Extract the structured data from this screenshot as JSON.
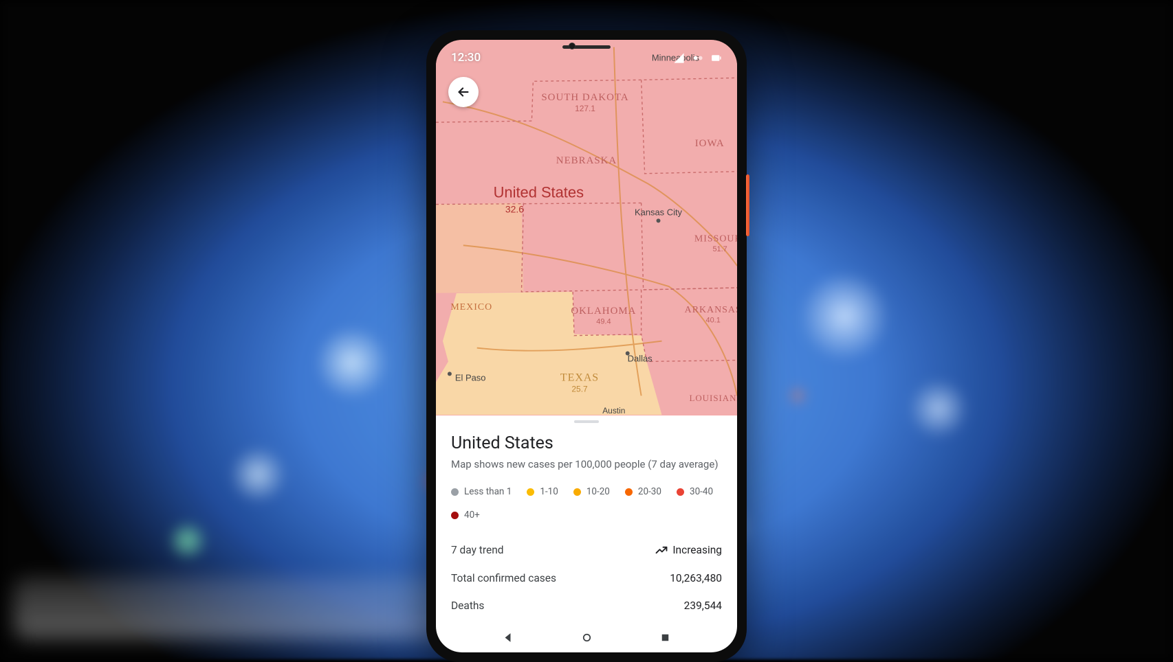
{
  "status_bar": {
    "time": "12:30"
  },
  "map_labels": {
    "minneapolis": "Minneapolis",
    "south_dakota": "SOUTH DAKOTA",
    "south_dakota_value": "127.1",
    "iowa": "IOWA",
    "nebraska": "NEBRASKA",
    "kansas_city": "Kansas City",
    "missouri": "MISSOURI",
    "missouri_value": "51.7",
    "country": "United States",
    "country_value": "32.6",
    "mexico": "MEXICO",
    "oklahoma": "OKLAHOMA",
    "oklahoma_value": "49.4",
    "arkansas": "ARKANSAS",
    "arkansas_value": "40.1",
    "el_paso": "El Paso",
    "texas": "TEXAS",
    "texas_value": "25.7",
    "dallas": "Dallas",
    "austin": "Austin",
    "louisiana": "LOUISIANA"
  },
  "sheet": {
    "title": "United States",
    "subtitle": "Map shows new cases per 100,000 people (7 day average)",
    "trend_label": "7 day trend",
    "trend_value": "Increasing",
    "confirmed_label": "Total confirmed cases",
    "confirmed_value": "10,263,480",
    "deaths_label": "Deaths",
    "deaths_value": "239,544"
  },
  "legend": [
    {
      "color": "#9aa0a6",
      "label": "Less than 1"
    },
    {
      "color": "#fbbc04",
      "label": "1-10"
    },
    {
      "color": "#f9ab00",
      "label": "10-20"
    },
    {
      "color": "#f76700",
      "label": "20-30"
    },
    {
      "color": "#ea4335",
      "label": "30-40"
    },
    {
      "color": "#a50e0e",
      "label": "40+"
    }
  ]
}
